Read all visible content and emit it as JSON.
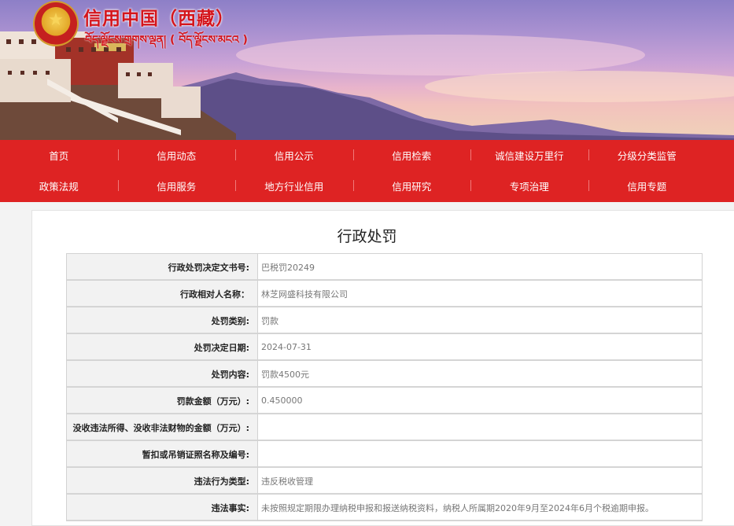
{
  "header": {
    "site_title": "信用中国（西藏）",
    "site_subtitle": "བོད་ལྗོངས་གྲགས་ལྡན། ( བོད་ལྗོངས་མངའ )"
  },
  "nav": {
    "row1": [
      "首页",
      "信用动态",
      "信用公示",
      "信用检索",
      "诚信建设万里行",
      "分级分类监管"
    ],
    "row2": [
      "政策法规",
      "信用服务",
      "地方行业信用",
      "信用研究",
      "专项治理",
      "信用专题"
    ]
  },
  "page": {
    "title": "行政处罚"
  },
  "record": {
    "rows": [
      {
        "label": "行政处罚决定文书号:",
        "value": "巴税罚20249"
      },
      {
        "label": "行政相对人名称：",
        "value": "林芝网盛科技有限公司"
      },
      {
        "label": "处罚类别:",
        "value": "罚款"
      },
      {
        "label": "处罚决定日期:",
        "value": "2024-07-31"
      },
      {
        "label": "处罚内容:",
        "value": "罚款4500元"
      },
      {
        "label": "罚款金额（万元）:",
        "value": "0.450000"
      },
      {
        "label": "没收违法所得、没收非法财物的金额（万元）:",
        "value": ""
      },
      {
        "label": "暂扣或吊销证照名称及编号:",
        "value": ""
      },
      {
        "label": "违法行为类型:",
        "value": "违反税收管理"
      },
      {
        "label": "违法事实:",
        "value": "未按照规定期限办理纳税申报和报送纳税资料，纳税人所属期2020年9月至2024年6月个税逾期申报。"
      }
    ]
  }
}
